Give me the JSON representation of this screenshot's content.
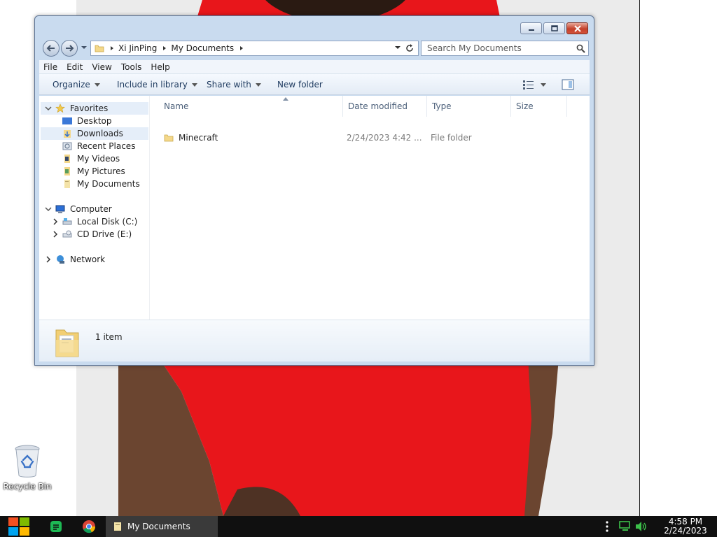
{
  "desktop": {
    "recycle_bin_label": "Recycle Bin",
    "shirt_color": "#e8161b"
  },
  "window": {
    "caption_buttons": [
      "minimize-icon",
      "maximize-icon",
      "close-icon"
    ],
    "address": {
      "breadcrumbs": [
        "Xi JinPing",
        "My Documents"
      ]
    },
    "search": {
      "placeholder": "Search My Documents"
    },
    "menu": [
      "File",
      "Edit",
      "View",
      "Tools",
      "Help"
    ],
    "commands": {
      "organize": "Organize",
      "include_in_library": "Include in library",
      "share_with": "Share with",
      "new_folder": "New folder"
    },
    "nav_pane": {
      "favorites": "Favorites",
      "favorites_items": [
        "Desktop",
        "Downloads",
        "Recent Places",
        "My Videos",
        "My Pictures",
        "My Documents"
      ],
      "computer": "Computer",
      "computer_items": [
        "Local Disk (C:)",
        "CD Drive (E:)"
      ],
      "network": "Network"
    },
    "columns": [
      "Name",
      "Date modified",
      "Type",
      "Size"
    ],
    "files": [
      {
        "name": "Minecraft",
        "date_modified": "2/24/2023 4:42 ...",
        "type": "File folder",
        "size": ""
      }
    ],
    "details": {
      "count": "1 item"
    }
  },
  "taskbar": {
    "open_task": "My Documents",
    "clock": {
      "time": "4:58 PM",
      "date": "2/24/2023"
    }
  }
}
